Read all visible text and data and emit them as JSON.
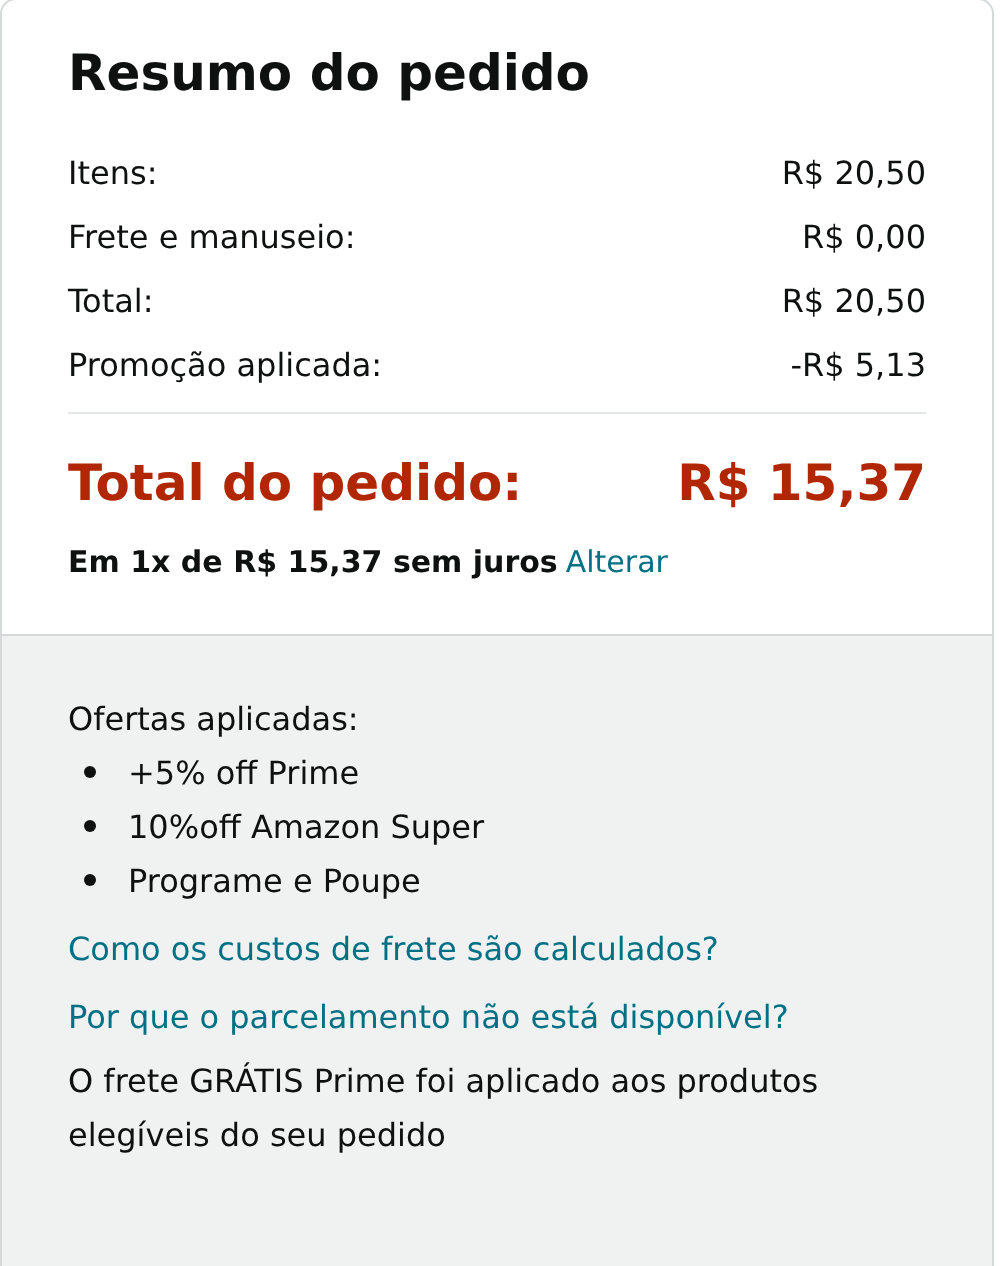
{
  "title": "Resumo do pedido",
  "lines": [
    {
      "label": "Itens:",
      "value": "R$ 20,50"
    },
    {
      "label": "Frete e manuseio:",
      "value": "R$ 0,00"
    },
    {
      "label": "Total:",
      "value": "R$ 20,50"
    },
    {
      "label": "Promoção aplicada:",
      "value": "-R$ 5,13"
    }
  ],
  "order_total": {
    "label": "Total do pedido:",
    "value": "R$ 15,37"
  },
  "installment": {
    "text": "Em 1x de R$ 15,37 sem juros",
    "link": "Alterar"
  },
  "offers": {
    "heading": "Ofertas aplicadas:",
    "items": [
      "+5% off Prime",
      "10%off Amazon Super",
      "Programe e Poupe"
    ]
  },
  "links": [
    "Como os custos de frete são calculados?",
    "Por que o parcelamento não está disponível?"
  ],
  "note": "O frete GRÁTIS Prime foi aplicado aos produtos elegíveis do seu pedido"
}
